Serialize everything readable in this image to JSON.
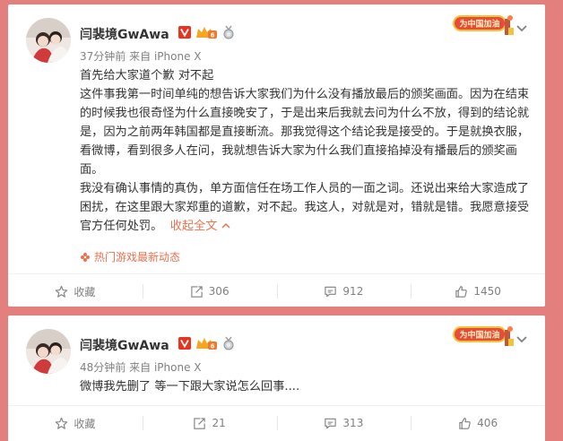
{
  "posts": [
    {
      "username": "闫裴境GwAwa",
      "time": "37分钟前",
      "from_prefix": "来自",
      "device": "iPhone X",
      "promo_text": "为中国加油",
      "paragraphs": [
        "首先给大家道个歉 对不起",
        "这件事我第一时间单纯的想告诉大家我们为什么没有播放最后的颁奖画面。因为在结束的时候我也很奇怪为什么直接晚安了，于是出来后我就去问为什么不放，得到的结论就是，因为之前两年韩国都是直接断流。那我觉得这个结论我是接受的。于是就换衣服，看微博，看到很多人在问，我就想告诉大家为什么我们直接掐掉没有播最后的颁奖画面。",
        "我没有确认事情的真伪，单方面信任在场工作人员的一面之词。还说出来给大家造成了困扰，在这里跟大家郑重的道歉，对不起。我这人，对就是对，错就是错。我愿意接受官方任何处罚。"
      ],
      "collapse_label": "收起全文",
      "source_label": "热门游戏最新动态",
      "actions": {
        "favorite": "收藏",
        "repost": "306",
        "comment": "912",
        "like": "1450"
      }
    },
    {
      "username": "闫裴境GwAwa",
      "time": "48分钟前",
      "from_prefix": "来自",
      "device": "iPhone X",
      "promo_text": "为中国加油",
      "paragraphs": [
        "微博我先删了 等一下跟大家说怎么回事...."
      ],
      "actions": {
        "favorite": "收藏",
        "repost": "21",
        "comment": "313",
        "like": "406"
      }
    }
  ],
  "colors": {
    "background": "#e3807d",
    "accent_orange": "#eb7350",
    "vip_orange": "#f5a623",
    "text": "#333333",
    "muted": "#808080"
  }
}
